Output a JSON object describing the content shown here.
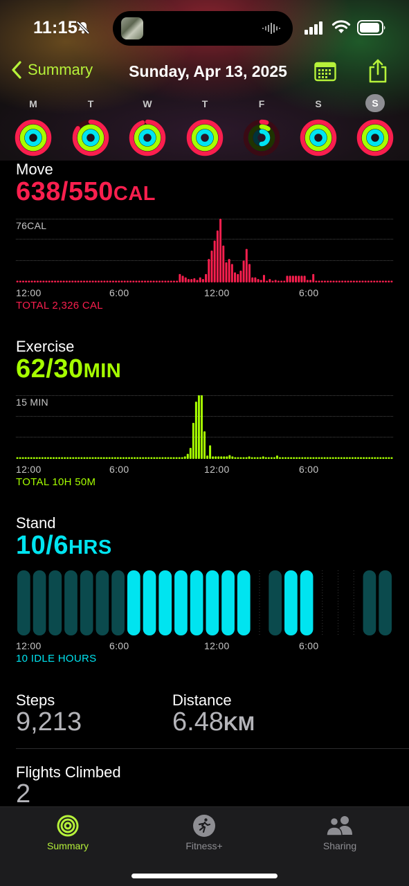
{
  "status": {
    "time": "11:15"
  },
  "nav": {
    "back_label": "Summary",
    "title": "Sunday, Apr 13, 2025"
  },
  "week": [
    {
      "label": "M",
      "move": 1.0,
      "exercise": 1.0,
      "stand": 1.0,
      "today": false
    },
    {
      "label": "T",
      "move": 0.85,
      "exercise": 1.0,
      "stand": 1.0,
      "today": false
    },
    {
      "label": "W",
      "move": 0.95,
      "exercise": 1.0,
      "stand": 1.0,
      "today": false
    },
    {
      "label": "T",
      "move": 1.0,
      "exercise": 1.0,
      "stand": 1.0,
      "today": false
    },
    {
      "label": "F",
      "move": 0.05,
      "exercise": 0.1,
      "stand": 0.5,
      "today": false
    },
    {
      "label": "S",
      "move": 1.0,
      "exercise": 1.0,
      "stand": 1.0,
      "today": false
    },
    {
      "label": "S",
      "move": 1.0,
      "exercise": 1.0,
      "stand": 1.0,
      "today": true
    }
  ],
  "colors": {
    "move": "#fa1f4e",
    "exercise": "#a6ff00",
    "stand": "#00e4f0",
    "accent": "#b6f23a"
  },
  "move": {
    "title": "Move",
    "value": "638/550",
    "unit": "CAL",
    "max_label": "76CAL",
    "total": "TOTAL 2,326 CAL",
    "x_labels": [
      "12:00",
      "6:00",
      "12:00",
      "6:00"
    ]
  },
  "exercise": {
    "title": "Exercise",
    "value": "62/30",
    "unit": "MIN",
    "max_label": "15 MIN",
    "total": "TOTAL 10H 50M",
    "x_labels": [
      "12:00",
      "6:00",
      "12:00",
      "6:00"
    ]
  },
  "stand": {
    "title": "Stand",
    "value": "10/6",
    "unit": "HRS",
    "total": "10 IDLE HOURS",
    "x_labels": [
      "12:00",
      "6:00",
      "12:00",
      "6:00"
    ]
  },
  "chart_data": [
    {
      "type": "bar",
      "title": "Move",
      "x_range": [
        "12:00",
        "12:00"
      ],
      "max_label": "76CAL",
      "values": [
        2,
        2,
        2,
        2,
        2,
        2,
        2,
        2,
        2,
        2,
        2,
        2,
        2,
        2,
        2,
        2,
        2,
        2,
        2,
        2,
        2,
        2,
        2,
        2,
        2,
        2,
        2,
        2,
        2,
        2,
        2,
        2,
        2,
        2,
        2,
        2,
        2,
        2,
        2,
        2,
        2,
        2,
        2,
        2,
        2,
        2,
        2,
        2,
        2,
        2,
        2,
        2,
        2,
        2,
        2,
        2,
        10,
        8,
        6,
        4,
        4,
        5,
        3,
        6,
        4,
        10,
        28,
        38,
        50,
        62,
        76,
        44,
        24,
        28,
        22,
        12,
        10,
        14,
        26,
        40,
        22,
        6,
        6,
        4,
        3,
        9,
        2,
        4,
        2,
        3,
        2,
        2,
        2,
        8,
        8,
        8,
        8,
        8,
        8,
        8,
        3,
        3,
        10,
        2,
        2,
        2,
        2,
        2,
        2,
        2,
        2,
        2,
        2,
        2,
        2,
        2,
        2,
        2,
        2,
        2,
        2,
        2,
        2,
        2,
        2,
        2,
        2,
        2,
        2,
        2
      ]
    },
    {
      "type": "bar",
      "title": "Exercise",
      "x_range": [
        "12:00",
        "12:00"
      ],
      "max_label": "15 MIN",
      "values": [
        0.4,
        0.4,
        0.4,
        0.4,
        0.4,
        0.4,
        0.4,
        0.4,
        0.4,
        0.4,
        0.4,
        0.4,
        0.4,
        0.4,
        0.4,
        0.4,
        0.4,
        0.4,
        0.4,
        0.4,
        0.4,
        0.4,
        0.4,
        0.4,
        0.4,
        0.4,
        0.4,
        0.4,
        0.4,
        0.4,
        0.4,
        0.4,
        0.4,
        0.4,
        0.4,
        0.4,
        0.4,
        0.4,
        0.4,
        0.4,
        0.4,
        0.4,
        0.4,
        0.4,
        0.4,
        0.4,
        0.4,
        0.4,
        0.4,
        0.4,
        0.4,
        0.4,
        0.4,
        0.4,
        0.4,
        0.4,
        0.4,
        0.4,
        0.4,
        0.4,
        0.6,
        1.2,
        2.6,
        8.5,
        13.5,
        15,
        15,
        6.5,
        0.8,
        3.2,
        0.6,
        0.6,
        0.6,
        0.6,
        0.6,
        0.6,
        0.9,
        0.6,
        0.4,
        0.4,
        0.4,
        0.4,
        0.4,
        0.6,
        0.4,
        0.4,
        0.4,
        0.4,
        0.6,
        0.4,
        0.4,
        0.4,
        0.4,
        0.8,
        0.4,
        0.4,
        0.4,
        0.4,
        0.4,
        0.4,
        0.4,
        0.4,
        0.4,
        0.4,
        0.4,
        0.4,
        0.4,
        0.4,
        0.4,
        0.4,
        0.4,
        0.4,
        0.4,
        0.4,
        0.4,
        0.4,
        0.4,
        0.4,
        0.4,
        0.4,
        0.4,
        0.4,
        0.4,
        0.4,
        0.4,
        0.4,
        0.4,
        0.4,
        0.4,
        0.4,
        0.4,
        0.4,
        0.4,
        0.4,
        0.4
      ]
    },
    {
      "type": "bar",
      "title": "Stand",
      "x_range": [
        "12:00",
        "12:00"
      ],
      "hours": [
        "idle",
        "idle",
        "idle",
        "idle",
        "idle",
        "idle",
        "idle",
        "stood",
        "stood",
        "stood",
        "stood",
        "stood",
        "stood",
        "stood",
        "stood",
        "none",
        "idle",
        "stood",
        "stood",
        "none",
        "none",
        "none",
        "idle",
        "idle"
      ]
    }
  ],
  "summary": {
    "steps_title": "Steps",
    "steps_value": "9,213",
    "distance_title": "Distance",
    "distance_value": "6.48",
    "distance_unit": "KM",
    "flights_title": "Flights Climbed",
    "flights_value": "2"
  },
  "tabs": [
    {
      "label": "Summary",
      "active": true
    },
    {
      "label": "Fitness+",
      "active": false
    },
    {
      "label": "Sharing",
      "active": false
    }
  ]
}
